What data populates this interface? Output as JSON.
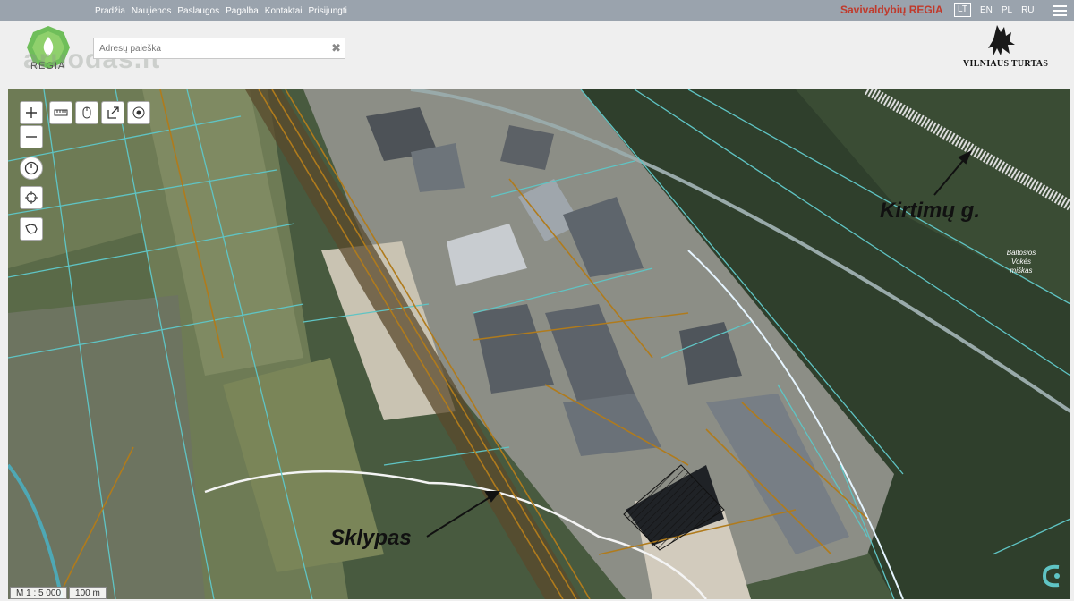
{
  "nav": {
    "items": [
      "Pradžia",
      "Naujienos",
      "Paslaugos",
      "Pagalba",
      "Kontaktai",
      "Prisijungti"
    ],
    "brand": "Savivaldybių REGIA",
    "languages": [
      "LT",
      "EN",
      "PL",
      "RU"
    ],
    "active_language": "LT"
  },
  "header": {
    "logo_text": "REGIA",
    "watermark": "aruodas.lt",
    "search_placeholder": "Adresų paieška",
    "partner_logo_text": "VILNIAUS TURTAS"
  },
  "map": {
    "labels": {
      "street": "Kirtimų g.",
      "plot": "Sklypas",
      "forest": [
        "Baltosios",
        "Vokės",
        "miškas"
      ]
    },
    "scale": "M 1 : 5 000",
    "scale_distance": "100 m",
    "tools": [
      "zoom-in",
      "zoom-out",
      "measure",
      "mouse",
      "export",
      "locate",
      "clock",
      "crosshair",
      "lithuania"
    ]
  },
  "colors": {
    "topbar": "#9aa3ad",
    "brand_red": "#c0392b",
    "parcel_outline": "#5fc4c4",
    "utility_lines": "#b07b1c"
  }
}
